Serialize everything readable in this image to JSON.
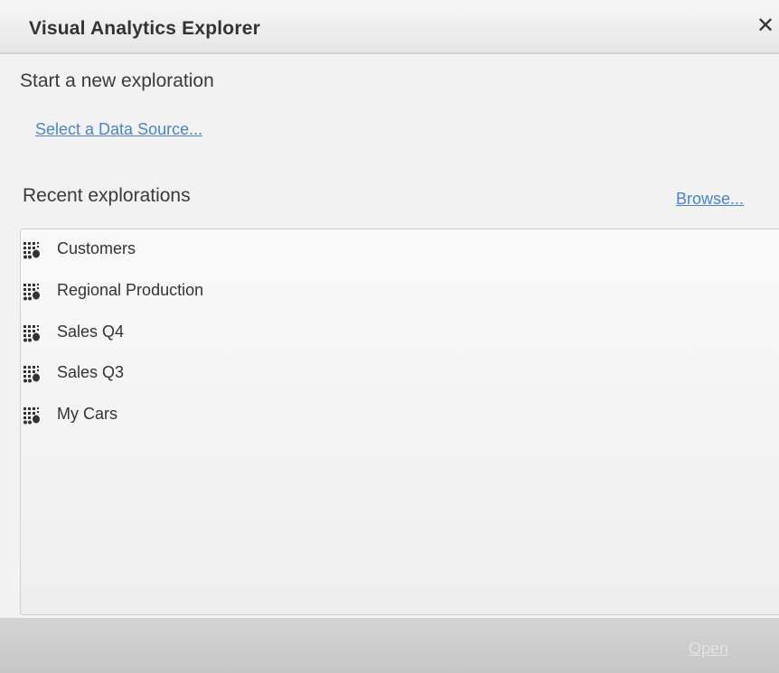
{
  "window": {
    "title": "Visual Analytics Explorer",
    "close_icon": "close-icon"
  },
  "start": {
    "heading": "Start a new exploration",
    "select_link": "Select a Data Source..."
  },
  "recent": {
    "heading": "Recent explorations",
    "browse_link": "Browse...",
    "item_icon": "exploration-icon",
    "items": [
      {
        "label": "Customers"
      },
      {
        "label": "Regional Production"
      },
      {
        "label": "Sales Q4"
      },
      {
        "label": "Sales Q3"
      },
      {
        "label": "My Cars"
      }
    ]
  },
  "footer": {
    "open_label": "Open",
    "open_enabled": false
  },
  "colors": {
    "link": "#4c84c6",
    "disabled_text": "#e2e2e2",
    "background": "#f2f2f2"
  }
}
